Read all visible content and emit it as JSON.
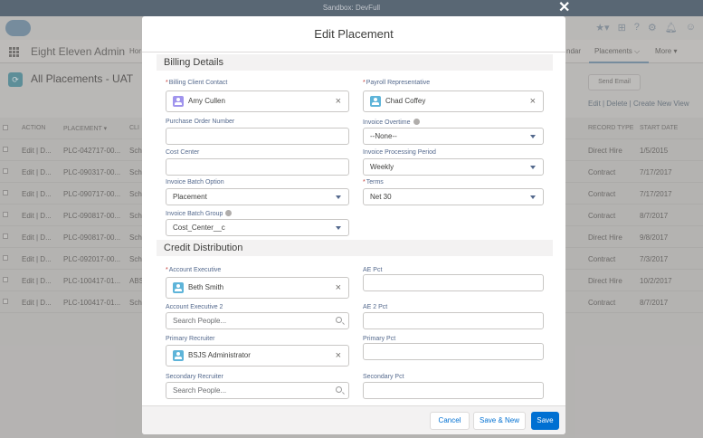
{
  "sandbox_banner": "Sandbox: DevFull",
  "background": {
    "app_name": "Eight Eleven Admin",
    "nav_items": [
      "Hor",
      "ndar"
    ],
    "active_tab": "Placements",
    "more_label": "More",
    "list_view_title": "All Placements - UAT",
    "send_email_label": "Send Email",
    "list_links": "Edit | Delete | Create New View",
    "columns": [
      "ACTION",
      "PLACEMENT",
      "CLI",
      "RECORD TYPE",
      "START DATE"
    ],
    "rows": [
      {
        "action": "Edit | D...",
        "placement": "PLC-042717-00...",
        "client": "Schr",
        "record_type": "Direct Hire",
        "start_date": "1/5/2015"
      },
      {
        "action": "Edit | D...",
        "placement": "PLC-090317-00...",
        "client": "Schr",
        "record_type": "Contract",
        "start_date": "7/17/2017"
      },
      {
        "action": "Edit | D...",
        "placement": "PLC-090717-00...",
        "client": "Schr",
        "record_type": "Contract",
        "start_date": "7/17/2017"
      },
      {
        "action": "Edit | D...",
        "placement": "PLC-090817-00...",
        "client": "Schr",
        "record_type": "Contract",
        "start_date": "8/7/2017"
      },
      {
        "action": "Edit | D...",
        "placement": "PLC-090817-00...",
        "client": "Schr",
        "record_type": "Direct Hire",
        "start_date": "9/8/2017"
      },
      {
        "action": "Edit | D...",
        "placement": "PLC-092017-00...",
        "client": "Schr",
        "record_type": "Contract",
        "start_date": "7/3/2017"
      },
      {
        "action": "Edit | D...",
        "placement": "PLC-100417-01...",
        "client": "ABS",
        "record_type": "Direct Hire",
        "start_date": "10/2/2017"
      },
      {
        "action": "Edit | D...",
        "placement": "PLC-100417-01...",
        "client": "Schr",
        "record_type": "Contract",
        "start_date": "8/7/2017"
      }
    ]
  },
  "modal": {
    "title": "Edit Placement",
    "billing_section": "Billing Details",
    "credit_section": "Credit Distribution",
    "fields": {
      "billing_client_contact": {
        "label": "Billing Client Contact",
        "value": "Amy Cullen"
      },
      "payroll_representative": {
        "label": "Payroll Representative",
        "value": "Chad Coffey"
      },
      "purchase_order_number": {
        "label": "Purchase Order Number",
        "value": ""
      },
      "invoice_overtime": {
        "label": "Invoice Overtime",
        "value": "--None--"
      },
      "cost_center": {
        "label": "Cost Center",
        "value": ""
      },
      "invoice_processing_period": {
        "label": "Invoice Processing Period",
        "value": "Weekly"
      },
      "invoice_batch_option": {
        "label": "Invoice Batch Option",
        "value": "Placement"
      },
      "terms": {
        "label": "Terms",
        "value": "Net 30"
      },
      "invoice_batch_group": {
        "label": "Invoice Batch Group",
        "value": "Cost_Center__c"
      },
      "account_executive": {
        "label": "Account Executive",
        "value": "Beth Smith"
      },
      "ae_pct": {
        "label": "AE Pct",
        "value": ""
      },
      "account_executive_2": {
        "label": "Account Executive 2",
        "placeholder": "Search People..."
      },
      "ae2_pct": {
        "label": "AE 2 Pct",
        "value": ""
      },
      "primary_recruiter": {
        "label": "Primary Recruiter",
        "value": "BSJS Administrator"
      },
      "primary_pct": {
        "label": "Primary Pct",
        "value": ""
      },
      "secondary_recruiter": {
        "label": "Secondary Recruiter",
        "placeholder": "Search People..."
      },
      "secondary_pct": {
        "label": "Secondary Pct",
        "value": ""
      }
    },
    "buttons": {
      "cancel": "Cancel",
      "save_new": "Save & New",
      "save": "Save"
    }
  },
  "colors": {
    "brand": "#0070d2",
    "required": "#c23934",
    "contact_icon": "#a094ed",
    "user_icon": "#5eb4d9"
  }
}
